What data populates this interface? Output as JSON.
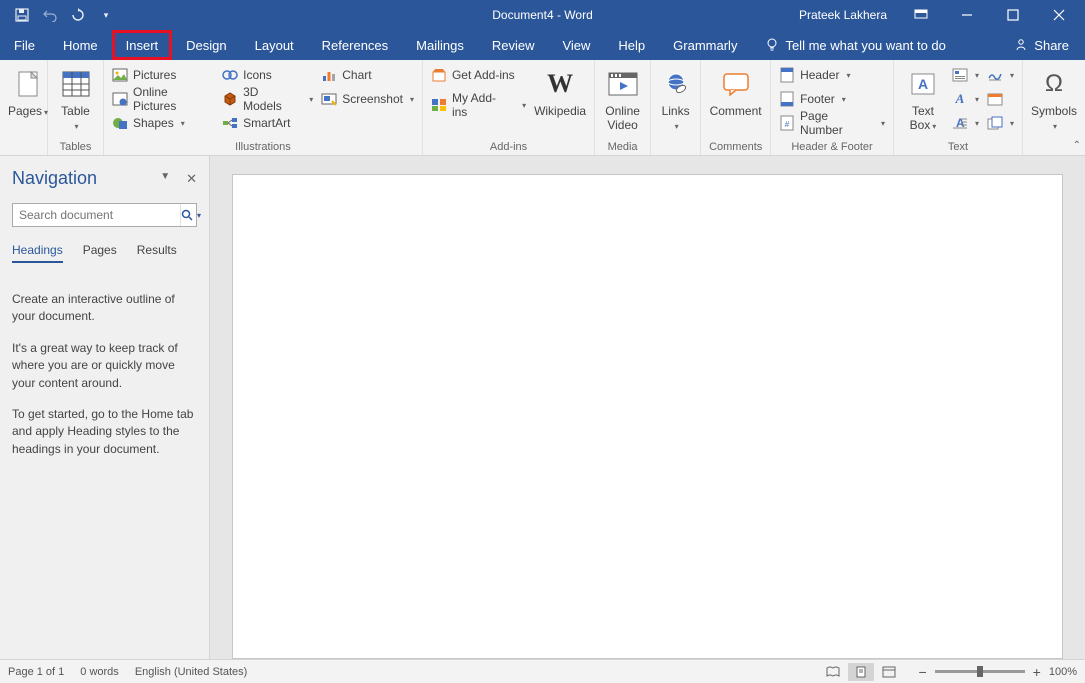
{
  "title": {
    "doc": "Document4",
    "sep": "  -  ",
    "app": "Word"
  },
  "user": "Prateek Lakhera",
  "tabs": [
    "File",
    "Home",
    "Insert",
    "Design",
    "Layout",
    "References",
    "Mailings",
    "Review",
    "View",
    "Help",
    "Grammarly"
  ],
  "tell_me": "Tell me what you want to do",
  "share": "Share",
  "ribbon": {
    "pages": {
      "label": "Pages"
    },
    "tables": {
      "btn": "Table",
      "label": "Tables"
    },
    "illustrations": {
      "pictures": "Pictures",
      "online_pictures": "Online Pictures",
      "shapes": "Shapes",
      "icons": "Icons",
      "models": "3D Models",
      "smartart": "SmartArt",
      "chart": "Chart",
      "screenshot": "Screenshot",
      "label": "Illustrations"
    },
    "addins": {
      "get": "Get Add-ins",
      "my": "My Add-ins",
      "wiki": "Wikipedia",
      "label": "Add-ins"
    },
    "media": {
      "btn1": "Online",
      "btn2": "Video",
      "label": "Media"
    },
    "links": {
      "btn": "Links"
    },
    "comments": {
      "btn": "Comment",
      "label": "Comments"
    },
    "hf": {
      "header": "Header",
      "footer": "Footer",
      "page_number": "Page Number",
      "label": "Header & Footer"
    },
    "text": {
      "textbox1": "Text",
      "textbox2": "Box",
      "label": "Text"
    },
    "symbols": {
      "btn": "Symbols"
    }
  },
  "nav": {
    "title": "Navigation",
    "search_placeholder": "Search document",
    "tabs": [
      "Headings",
      "Pages",
      "Results"
    ],
    "help": [
      "Create an interactive outline of your document.",
      "It's a great way to keep track of where you are or quickly move your content around.",
      "To get started, go to the Home tab and apply Heading styles to the headings in your document."
    ]
  },
  "status": {
    "page": "Page 1 of 1",
    "words": "0 words",
    "lang": "English (United States)",
    "zoom": "100%"
  }
}
